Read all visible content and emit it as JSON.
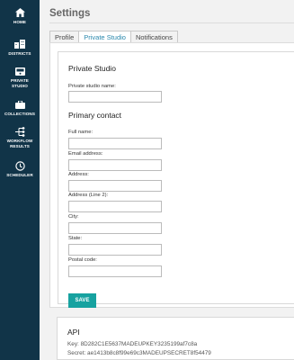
{
  "sidebar": {
    "items": [
      {
        "label": "HOME",
        "icon": "home-icon"
      },
      {
        "label": "DISTRICTS",
        "icon": "districts-icon"
      },
      {
        "label": "PRIVATE STUDIO",
        "icon": "private-studio-icon"
      },
      {
        "label": "COLLECTIONS",
        "icon": "collections-icon"
      },
      {
        "label": "WORKFLOW RESULTS",
        "icon": "workflow-results-icon"
      },
      {
        "label": "SCHEDULER",
        "icon": "scheduler-icon"
      }
    ]
  },
  "page": {
    "title": "Settings"
  },
  "tabs": [
    {
      "label": "Profile",
      "active": false
    },
    {
      "label": "Private Studio",
      "active": true
    },
    {
      "label": "Notifications",
      "active": false
    }
  ],
  "form": {
    "studio_heading": "Private Studio",
    "studio_name_label": "Private studio name:",
    "studio_name_value": "",
    "contact_heading": "Primary contact",
    "fields": [
      {
        "label": "Full name:",
        "value": ""
      },
      {
        "label": "Email address:",
        "value": ""
      },
      {
        "label": "Address:",
        "value": ""
      },
      {
        "label": "Address (Line 2):",
        "value": ""
      },
      {
        "label": "City:",
        "value": ""
      },
      {
        "label": "State:",
        "value": ""
      },
      {
        "label": "Postal code:",
        "value": ""
      }
    ],
    "save_label": "SAVE"
  },
  "api": {
    "title": "API",
    "key_line": "Key: 8D282C1E5637MADEUPKEY3235199af7c8a",
    "secret_line": "Secret: ae1413b8c8f99e69c3MADEUPSECRET8f54479"
  },
  "colors": {
    "sidebar": "#113448",
    "accent": "#17a2a0",
    "tab_active_text": "#2a88ad"
  }
}
